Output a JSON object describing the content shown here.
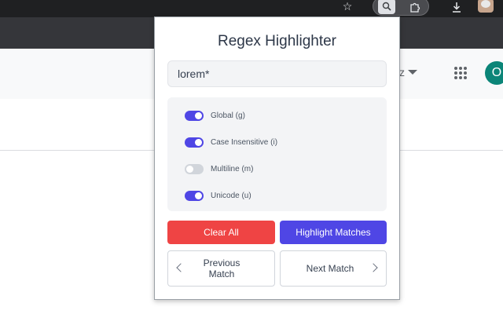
{
  "browser": {
    "toolbar_icons": [
      "star-icon",
      "regex-extension-icon",
      "extensions-puzzle-icon",
      "download-icon",
      "profile-avatar"
    ]
  },
  "page": {
    "partial_text": "z",
    "account_initial": "O"
  },
  "popup": {
    "title": "Regex Highlighter",
    "pattern": {
      "value": "lorem*",
      "placeholder": ""
    },
    "options": [
      {
        "label": "Global (g)",
        "enabled": true
      },
      {
        "label": "Case Insensitive (i)",
        "enabled": true
      },
      {
        "label": "Multiline (m)",
        "enabled": false
      },
      {
        "label": "Unicode (u)",
        "enabled": true
      }
    ],
    "buttons": {
      "clear": "Clear All",
      "highlight": "Highlight Matches",
      "previous": "Previous Match",
      "next": "Next Match"
    }
  },
  "colors": {
    "accent": "#4f46e5",
    "danger": "#ef4444",
    "toggle_off": "#d1d5db",
    "account_avatar": "#0b8578"
  }
}
